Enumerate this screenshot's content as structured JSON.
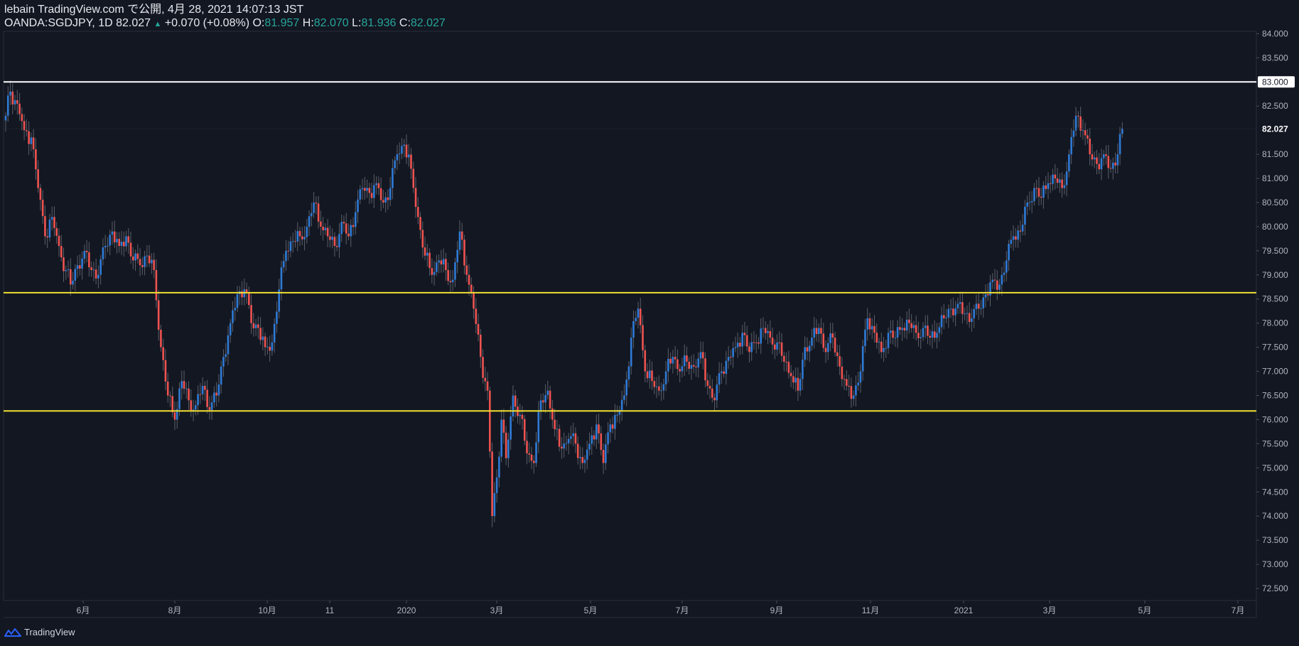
{
  "header": {
    "published_line": "lebain TradingView.com で公開, 4月 28, 2021 14:07:13 JST",
    "symbol": "OANDA:SGDJPY, 1D",
    "last_price": "82.027",
    "change_arrow": "▲",
    "change": "+0.070 (+0.08%)",
    "open_label": "O:",
    "open": "81.957",
    "high_label": "H:",
    "high": "82.070",
    "low_label": "L:",
    "low": "81.936",
    "close_label": "C:",
    "close": "82.027"
  },
  "footer": {
    "brand": "TradingView"
  },
  "colors": {
    "background": "#131722",
    "bull": "#2f7bd6",
    "bear": "#ef5350",
    "resistance_line": "#ffffff",
    "support_lines": "#f0e130",
    "axis_text": "#b2b5be"
  },
  "chart_data": {
    "type": "candlestick",
    "title": "OANDA:SGDJPY, 1D",
    "ylim": [
      72.25,
      84.05
    ],
    "y_ticks": [
      "84.000",
      "83.500",
      "83.000",
      "82.500",
      "82.027",
      "81.500",
      "81.000",
      "80.500",
      "80.000",
      "79.500",
      "79.000",
      "78.500",
      "78.000",
      "77.500",
      "77.000",
      "76.500",
      "76.000",
      "75.500",
      "75.000",
      "74.500",
      "74.000",
      "73.500",
      "73.000",
      "72.500"
    ],
    "x_ticks": [
      "6月",
      "8月",
      "10月",
      "11",
      "2020",
      "3月",
      "5月",
      "7月",
      "9月",
      "11月",
      "2021",
      "3月",
      "5月",
      "7月"
    ],
    "current_price": 82.027,
    "horizontal_lines": [
      {
        "price": 83.0,
        "label": "83.000",
        "role": "resistance"
      },
      {
        "price": 78.63,
        "role": "support"
      },
      {
        "price": 76.18,
        "role": "support"
      }
    ],
    "series": [
      {
        "close_path": [
          [
            0,
            82.3
          ],
          [
            2,
            82.8
          ],
          [
            5,
            82.55
          ],
          [
            8,
            82.0
          ],
          [
            11,
            81.85
          ],
          [
            14,
            80.8
          ],
          [
            17,
            79.8
          ],
          [
            20,
            80.2
          ],
          [
            23,
            79.6
          ],
          [
            26,
            79.1
          ],
          [
            28,
            78.8
          ],
          [
            31,
            79.2
          ],
          [
            34,
            79.5
          ],
          [
            37,
            79.1
          ],
          [
            40,
            79.0
          ],
          [
            43,
            79.6
          ],
          [
            46,
            79.9
          ],
          [
            49,
            79.6
          ],
          [
            52,
            79.8
          ],
          [
            55,
            79.3
          ],
          [
            58,
            79.2
          ],
          [
            61,
            79.4
          ],
          [
            64,
            79.1
          ],
          [
            67,
            77.5
          ],
          [
            70,
            76.5
          ],
          [
            73,
            76.0
          ],
          [
            76,
            76.8
          ],
          [
            79,
            76.4
          ],
          [
            82,
            76.3
          ],
          [
            85,
            76.7
          ],
          [
            88,
            76.2
          ],
          [
            91,
            76.5
          ],
          [
            94,
            77.3
          ],
          [
            97,
            78.0
          ],
          [
            100,
            78.6
          ],
          [
            103,
            78.7
          ],
          [
            106,
            78.0
          ],
          [
            109,
            77.9
          ],
          [
            112,
            77.5
          ],
          [
            115,
            77.6
          ],
          [
            118,
            78.7
          ],
          [
            121,
            79.5
          ],
          [
            124,
            79.7
          ],
          [
            127,
            79.8
          ],
          [
            130,
            80.0
          ],
          [
            133,
            80.5
          ],
          [
            136,
            80.0
          ],
          [
            139,
            79.8
          ],
          [
            142,
            79.6
          ],
          [
            145,
            80.1
          ],
          [
            148,
            79.8
          ],
          [
            151,
            80.3
          ],
          [
            154,
            80.8
          ],
          [
            157,
            80.7
          ],
          [
            160,
            80.9
          ],
          [
            163,
            80.5
          ],
          [
            166,
            80.8
          ],
          [
            169,
            81.5
          ],
          [
            172,
            81.7
          ],
          [
            175,
            81.2
          ],
          [
            178,
            80.2
          ],
          [
            181,
            79.4
          ],
          [
            184,
            79.0
          ],
          [
            187,
            79.3
          ],
          [
            190,
            79.1
          ],
          [
            193,
            78.9
          ],
          [
            196,
            79.9
          ],
          [
            199,
            79.0
          ],
          [
            202,
            78.3
          ],
          [
            205,
            77.3
          ],
          [
            208,
            76.6
          ],
          [
            210,
            74.0
          ],
          [
            212,
            74.8
          ],
          [
            214,
            76.0
          ],
          [
            216,
            75.2
          ],
          [
            219,
            76.5
          ],
          [
            222,
            76.1
          ],
          [
            225,
            75.3
          ],
          [
            228,
            75.1
          ],
          [
            231,
            76.4
          ],
          [
            234,
            76.6
          ],
          [
            237,
            75.8
          ],
          [
            240,
            75.4
          ],
          [
            243,
            75.6
          ],
          [
            246,
            75.5
          ],
          [
            249,
            75.1
          ],
          [
            252,
            75.5
          ],
          [
            255,
            75.9
          ],
          [
            258,
            75.1
          ],
          [
            261,
            75.9
          ],
          [
            264,
            76.1
          ],
          [
            267,
            76.5
          ],
          [
            270,
            77.7
          ],
          [
            273,
            78.3
          ],
          [
            276,
            77.0
          ],
          [
            279,
            76.8
          ],
          [
            282,
            76.6
          ],
          [
            285,
            77.0
          ],
          [
            288,
            77.3
          ],
          [
            291,
            77.0
          ],
          [
            294,
            77.2
          ],
          [
            297,
            77.1
          ],
          [
            300,
            77.4
          ],
          [
            303,
            76.7
          ],
          [
            306,
            76.4
          ],
          [
            309,
            77.0
          ],
          [
            312,
            77.3
          ],
          [
            315,
            77.5
          ],
          [
            318,
            77.8
          ],
          [
            321,
            77.4
          ],
          [
            324,
            77.6
          ],
          [
            327,
            77.9
          ],
          [
            330,
            77.7
          ],
          [
            333,
            77.6
          ],
          [
            336,
            77.2
          ],
          [
            339,
            76.9
          ],
          [
            342,
            76.6
          ],
          [
            345,
            77.5
          ],
          [
            348,
            77.7
          ],
          [
            351,
            77.9
          ],
          [
            354,
            77.4
          ],
          [
            357,
            77.7
          ],
          [
            360,
            77.1
          ],
          [
            363,
            76.7
          ],
          [
            366,
            76.5
          ],
          [
            369,
            77.0
          ],
          [
            372,
            78.1
          ],
          [
            375,
            77.8
          ],
          [
            378,
            77.4
          ],
          [
            381,
            77.8
          ],
          [
            384,
            77.7
          ],
          [
            387,
            77.9
          ],
          [
            390,
            78.0
          ],
          [
            393,
            77.8
          ],
          [
            396,
            77.9
          ],
          [
            399,
            77.7
          ],
          [
            402,
            77.8
          ],
          [
            405,
            78.1
          ],
          [
            408,
            78.3
          ],
          [
            411,
            78.4
          ],
          [
            414,
            78.2
          ],
          [
            417,
            78.1
          ],
          [
            420,
            78.3
          ],
          [
            423,
            78.6
          ],
          [
            426,
            78.9
          ],
          [
            429,
            78.8
          ],
          [
            432,
            79.3
          ],
          [
            435,
            79.8
          ],
          [
            438,
            79.9
          ],
          [
            441,
            80.5
          ],
          [
            444,
            80.8
          ],
          [
            447,
            80.6
          ],
          [
            450,
            80.9
          ],
          [
            453,
            81.0
          ],
          [
            456,
            80.8
          ],
          [
            459,
            81.5
          ],
          [
            462,
            82.3
          ],
          [
            465,
            82.0
          ],
          [
            468,
            81.5
          ],
          [
            471,
            81.3
          ],
          [
            474,
            81.5
          ],
          [
            477,
            81.2
          ],
          [
            480,
            81.5
          ],
          [
            482,
            82.03
          ]
        ]
      }
    ]
  }
}
